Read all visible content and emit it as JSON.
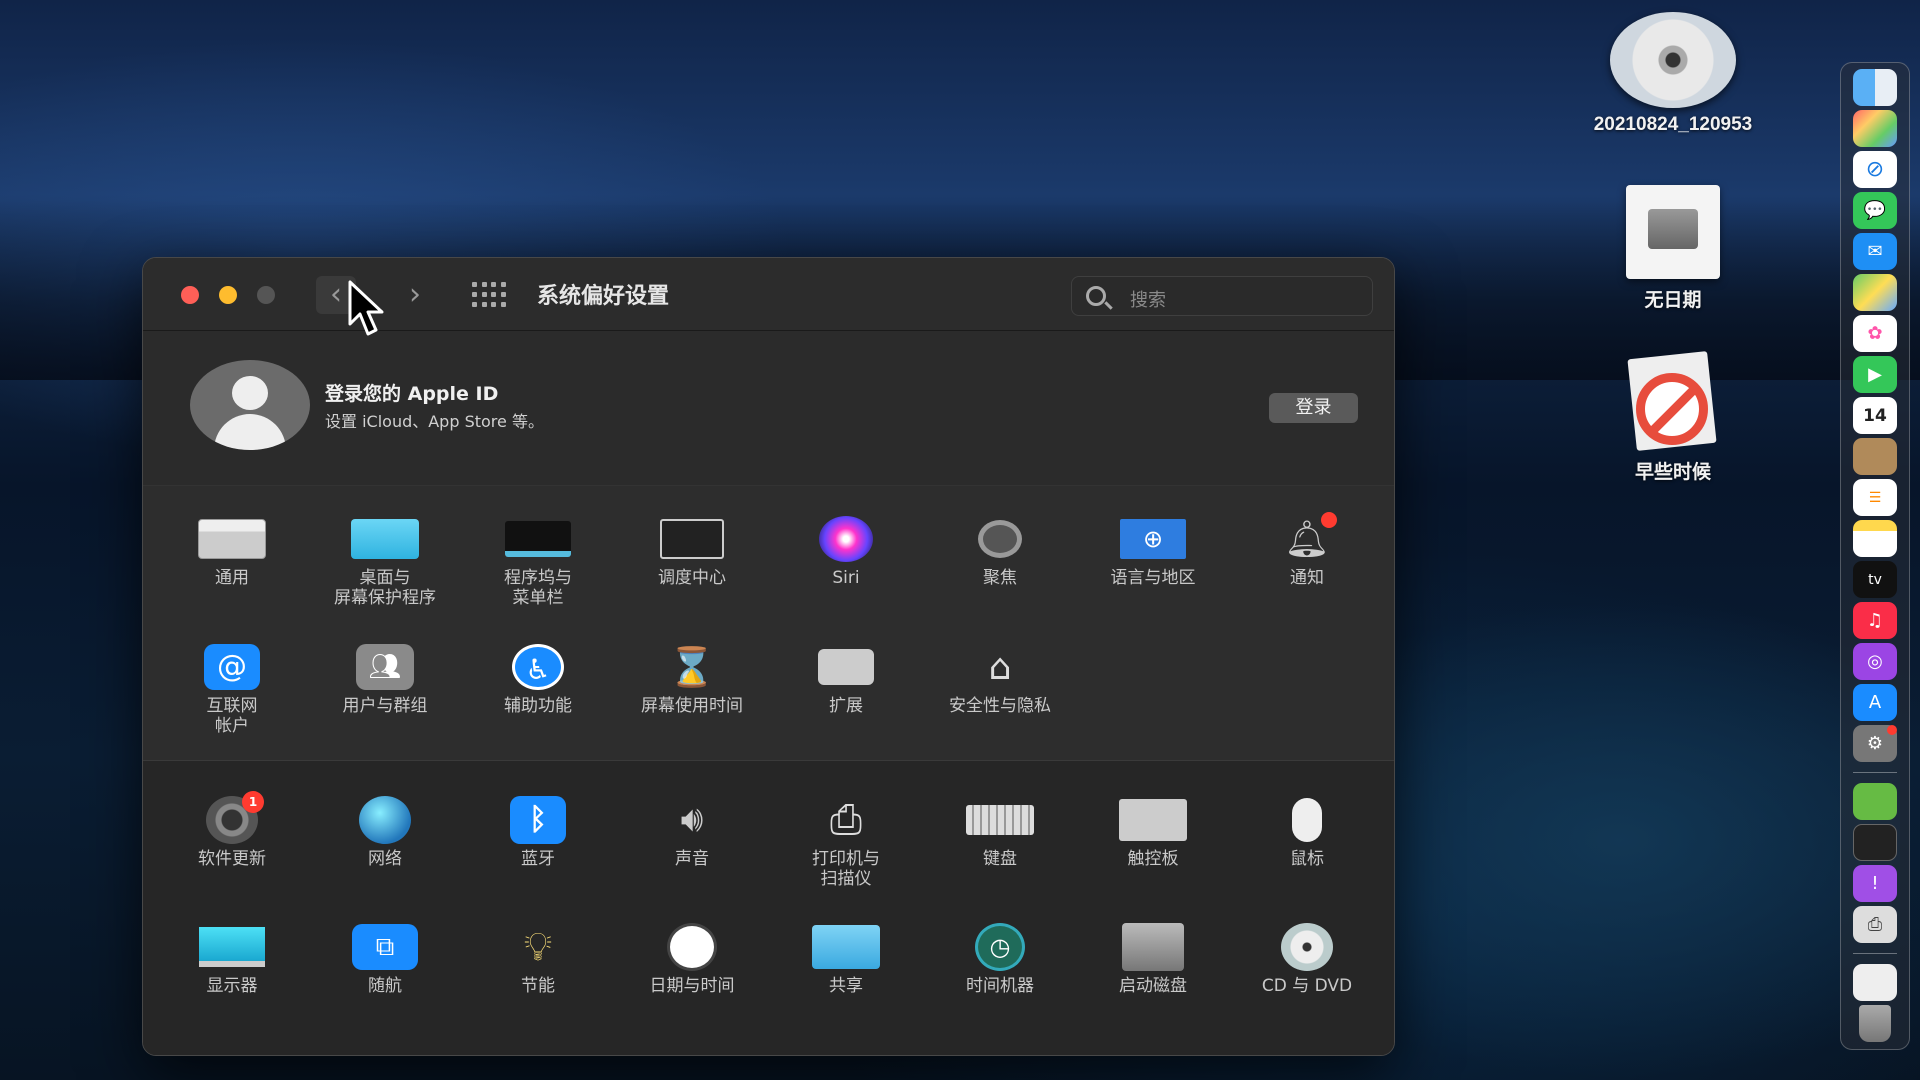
{
  "desktop": {
    "items": [
      {
        "label": "20210824_120953",
        "icon": "dvd-icon"
      },
      {
        "label": "无日期",
        "icon": "disk-image-icon"
      },
      {
        "label": "早些时候",
        "icon": "no-entry-icon"
      }
    ]
  },
  "window": {
    "title": "系统偏好设置",
    "search_placeholder": "搜索"
  },
  "account": {
    "title": "登录您的 Apple ID",
    "subtitle": "设置 iCloud、App Store 等。",
    "login_button": "登录"
  },
  "section1": {
    "items": [
      {
        "label": "通用",
        "icon": "general-icon"
      },
      {
        "label": "桌面与\n屏幕保护程序",
        "icon": "desktop-icon"
      },
      {
        "label": "程序坞与\n菜单栏",
        "icon": "dock-icon"
      },
      {
        "label": "调度中心",
        "icon": "mission-control-icon"
      },
      {
        "label": "Siri",
        "icon": "siri-icon"
      },
      {
        "label": "聚焦",
        "icon": "spotlight-icon"
      },
      {
        "label": "语言与地区",
        "icon": "language-icon"
      },
      {
        "label": "通知",
        "icon": "notification-icon"
      },
      {
        "label": "互联网\n帐户",
        "icon": "internet-accounts-icon"
      },
      {
        "label": "用户与群组",
        "icon": "users-icon"
      },
      {
        "label": "辅助功能",
        "icon": "accessibility-icon"
      },
      {
        "label": "屏幕使用时间",
        "icon": "screen-time-icon"
      },
      {
        "label": "扩展",
        "icon": "extensions-icon"
      },
      {
        "label": "安全性与隐私",
        "icon": "security-icon"
      }
    ]
  },
  "section2": {
    "items": [
      {
        "label": "软件更新",
        "icon": "software-update-icon",
        "badge": "1"
      },
      {
        "label": "网络",
        "icon": "network-icon"
      },
      {
        "label": "蓝牙",
        "icon": "bluetooth-icon"
      },
      {
        "label": "声音",
        "icon": "sound-icon"
      },
      {
        "label": "打印机与\n扫描仪",
        "icon": "printer-icon"
      },
      {
        "label": "键盘",
        "icon": "keyboard-icon"
      },
      {
        "label": "触控板",
        "icon": "trackpad-icon"
      },
      {
        "label": "鼠标",
        "icon": "mouse-icon"
      },
      {
        "label": "显示器",
        "icon": "display-icon"
      },
      {
        "label": "随航",
        "icon": "sidecar-icon"
      },
      {
        "label": "节能",
        "icon": "energy-icon"
      },
      {
        "label": "日期与时间",
        "icon": "clock-icon"
      },
      {
        "label": "共享",
        "icon": "sharing-icon"
      },
      {
        "label": "时间机器",
        "icon": "time-machine-icon"
      },
      {
        "label": "启动磁盘",
        "icon": "startup-disk-icon"
      },
      {
        "label": "CD 与 DVD",
        "icon": "cd-dvd-icon"
      }
    ]
  },
  "dock": {
    "calendar_day": "14",
    "tv_label": "tv"
  }
}
